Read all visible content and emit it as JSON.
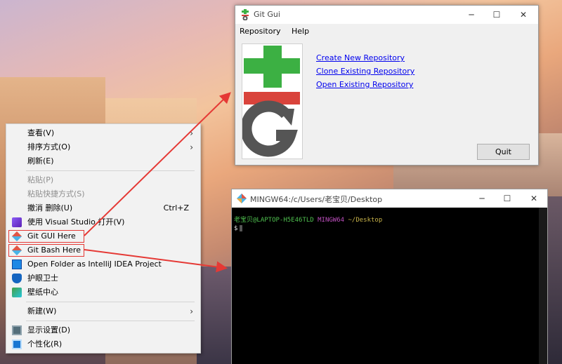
{
  "context_menu": {
    "items": [
      {
        "label": "查看(V)"
      },
      {
        "label": "排序方式(O)"
      },
      {
        "label": "刷新(E)"
      },
      {
        "label": "粘贴(P)"
      },
      {
        "label": "粘贴快捷方式(S)"
      },
      {
        "label": "撤消 删除(U)",
        "shortcut": "Ctrl+Z"
      },
      {
        "label": "使用 Visual Studio 打开(V)"
      },
      {
        "label": "Git GUI Here"
      },
      {
        "label": "Git Bash Here"
      },
      {
        "label": "Open Folder as IntelliJ IDEA Project"
      },
      {
        "label": "护眼卫士"
      },
      {
        "label": "壁纸中心"
      },
      {
        "label": "新建(W)"
      },
      {
        "label": "显示设置(D)"
      },
      {
        "label": "个性化(R)"
      }
    ]
  },
  "git_gui": {
    "title": "Git Gui",
    "menu": [
      "Repository",
      "Help"
    ],
    "links": [
      "Create New Repository",
      "Clone Existing Repository",
      "Open Existing Repository"
    ],
    "quit_label": "Quit"
  },
  "mingw": {
    "title": "MINGW64:/c/Users/老宝贝/Desktop",
    "prompt_user": "老宝贝@LAPTOP-H5E46TLD",
    "prompt_env": "MINGW64",
    "prompt_path": "~/Desktop",
    "prompt_symbol": "$"
  },
  "icons": {
    "submenu": "chevron-right-icon",
    "git": "git-icon",
    "visual_studio": "visual-studio-icon",
    "intellij": "intellij-icon",
    "eye_guard": "shield-icon",
    "wallpaper": "wallpaper-icon",
    "display": "display-icon",
    "personalize": "personalize-icon"
  },
  "colors": {
    "highlight": "#e53935",
    "link": "#0000ee",
    "prompt_green": "#4fc04f",
    "prompt_purple": "#c050c0",
    "prompt_yellow": "#c8b34a"
  }
}
